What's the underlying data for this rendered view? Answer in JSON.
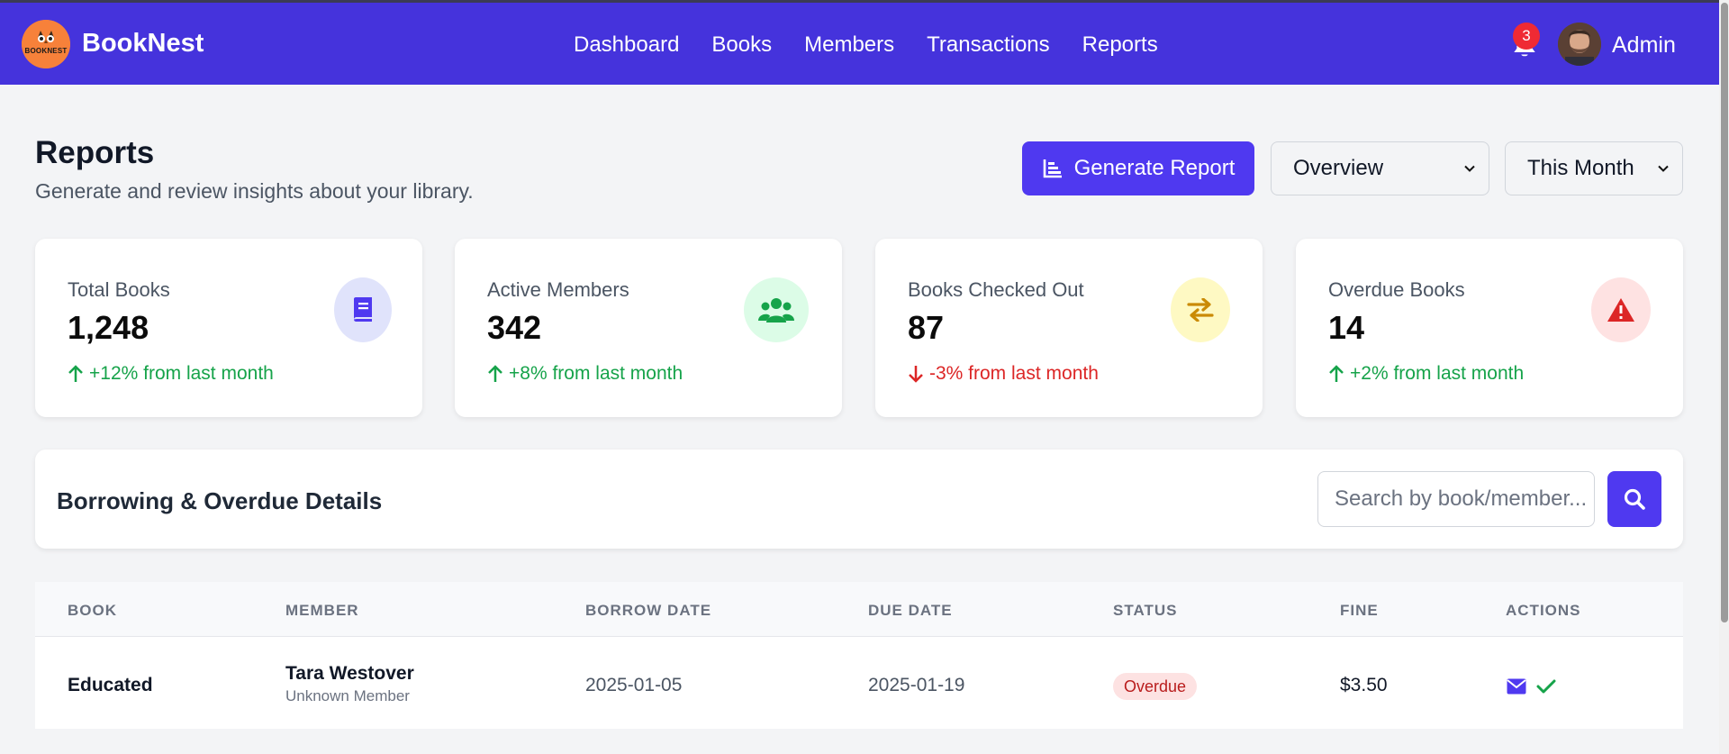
{
  "brand": {
    "name": "BookNest",
    "logo_text": "BOOKNEST"
  },
  "nav": {
    "links": [
      "Dashboard",
      "Books",
      "Members",
      "Transactions",
      "Reports"
    ]
  },
  "header": {
    "notification_count": "3",
    "user_name": "Admin"
  },
  "page": {
    "title": "Reports",
    "subtitle": "Generate and review insights about your library.",
    "generate_label": "Generate Report",
    "report_type": "Overview",
    "period": "This Month"
  },
  "stats": [
    {
      "label": "Total Books",
      "value": "1,248",
      "trend": "+12% from last month",
      "direction": "up",
      "icon": "book-icon",
      "color": "#16a34a",
      "icon_bg": "#e0e3fb",
      "icon_color": "#4f39f0"
    },
    {
      "label": "Active Members",
      "value": "342",
      "trend": "+8% from last month",
      "direction": "up",
      "icon": "users-icon",
      "color": "#16a34a",
      "icon_bg": "#dcfce7",
      "icon_color": "#16a34a"
    },
    {
      "label": "Books Checked Out",
      "value": "87",
      "trend": "-3% from last month",
      "direction": "down",
      "icon": "exchange-icon",
      "color": "#dc2626",
      "icon_bg": "#fef9c3",
      "icon_color": "#ca8a04"
    },
    {
      "label": "Overdue Books",
      "value": "14",
      "trend": "+2% from last month",
      "direction": "up",
      "icon": "warning-icon",
      "color": "#16a34a",
      "icon_bg": "#fee2e2",
      "icon_color": "#dc2626"
    }
  ],
  "borrowing": {
    "title": "Borrowing & Overdue Details",
    "search_placeholder": "Search by book/member..."
  },
  "table": {
    "columns": [
      "BOOK",
      "MEMBER",
      "BORROW DATE",
      "DUE DATE",
      "STATUS",
      "FINE",
      "ACTIONS"
    ],
    "rows": [
      {
        "book": "Educated",
        "member": "Tara Westover",
        "member_sub": "Unknown Member",
        "borrow_date": "2025-01-05",
        "due_date": "2025-01-19",
        "status": "Overdue",
        "fine": "$3.50"
      }
    ]
  },
  "colors": {
    "primary": "#4533dc",
    "accent": "#4f39f0",
    "success": "#16a34a",
    "danger": "#dc2626"
  }
}
